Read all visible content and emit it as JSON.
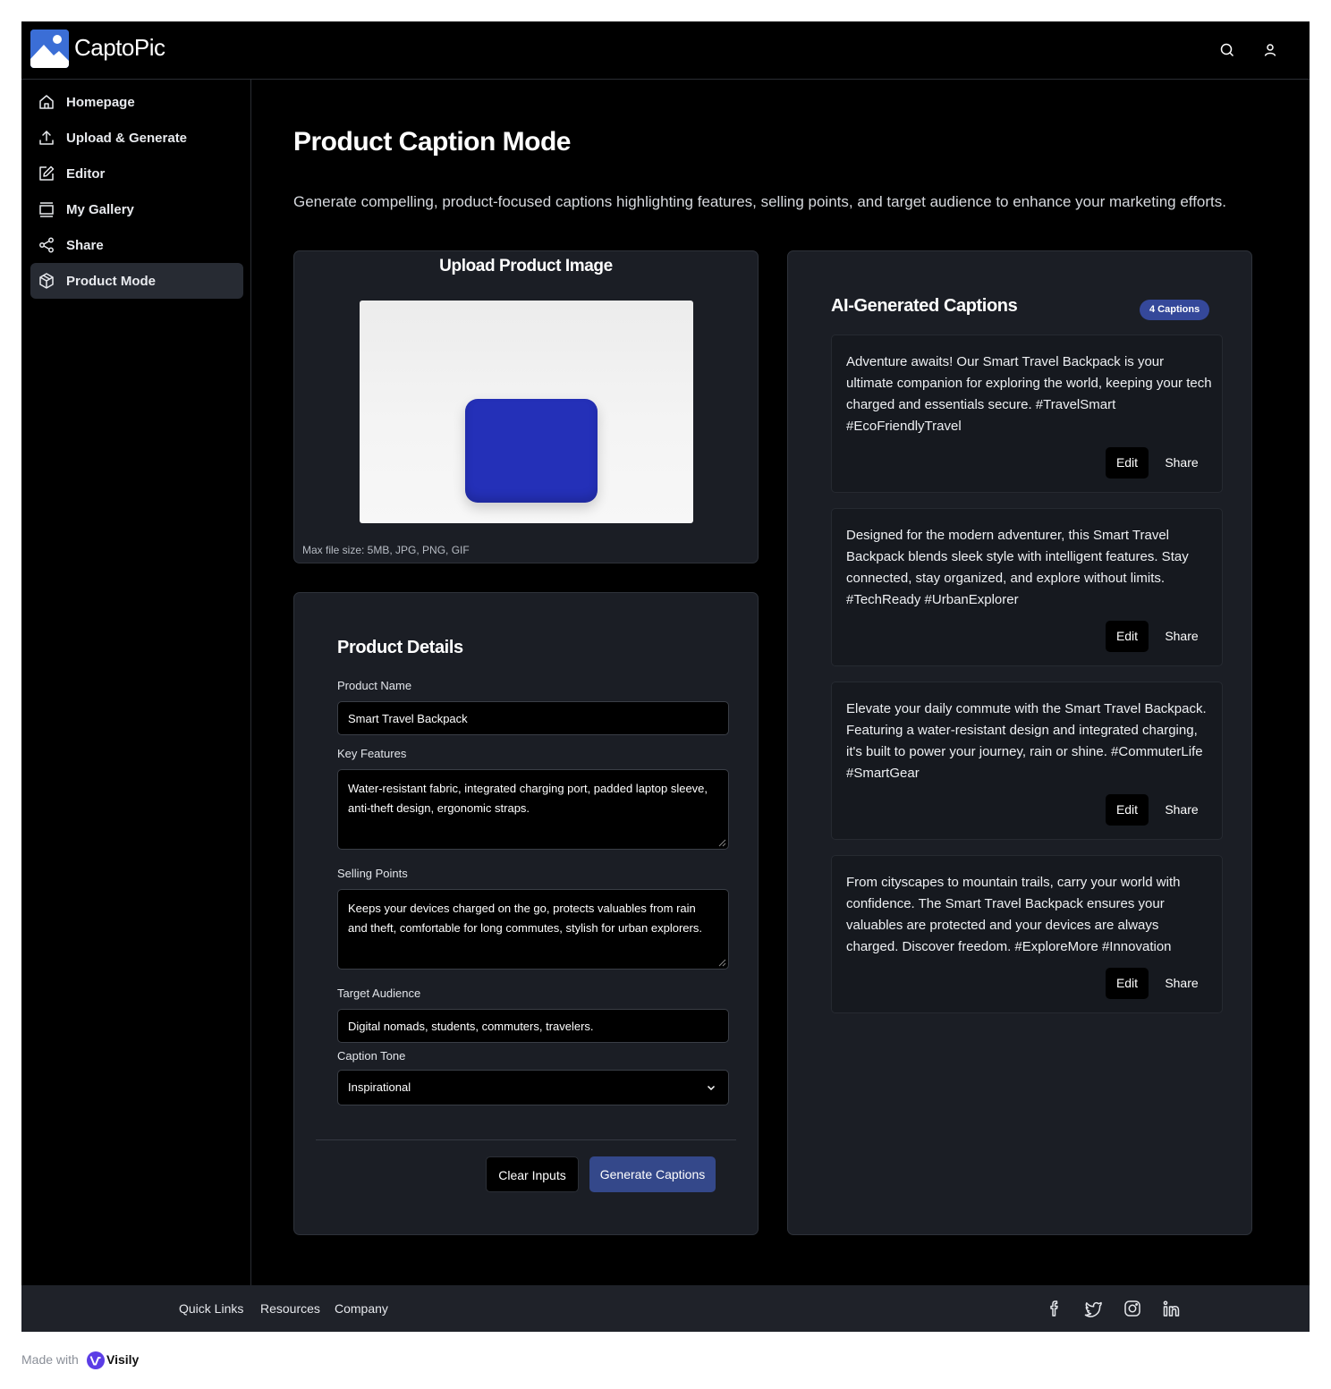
{
  "app": {
    "name": "CaptoPic"
  },
  "header": {
    "search_icon": "search-icon",
    "user_icon": "user-icon"
  },
  "sidebar": {
    "items": [
      {
        "label": "Homepage",
        "icon": "home-icon",
        "active": false
      },
      {
        "label": "Upload & Generate",
        "icon": "upload-icon",
        "active": false
      },
      {
        "label": "Editor",
        "icon": "edit-icon",
        "active": false
      },
      {
        "label": "My Gallery",
        "icon": "gallery-icon",
        "active": false
      },
      {
        "label": "Share",
        "icon": "share-icon",
        "active": false
      },
      {
        "label": "Product Mode",
        "icon": "box-icon",
        "active": true
      }
    ]
  },
  "page": {
    "title": "Product Caption Mode",
    "description": "Generate compelling, product-focused captions highlighting features, selling points, and target audience to enhance your marketing efforts."
  },
  "upload": {
    "title": "Upload Product Image",
    "hint": "Max file size: 5MB, JPG, PNG, GIF"
  },
  "details": {
    "title": "Product Details",
    "product_name_label": "Product Name",
    "product_name_value": "Smart Travel Backpack",
    "key_features_label": "Key Features",
    "key_features_value": "Water-resistant fabric, integrated charging port, padded laptop sleeve, anti-theft design, ergonomic straps.",
    "selling_points_label": "Selling Points",
    "selling_points_value": "Keeps your devices charged on the go, protects valuables from rain and theft, comfortable for long commutes, stylish for urban explorers.",
    "target_audience_label": "Target Audience",
    "target_audience_value": "Digital nomads, students, commuters, travelers.",
    "caption_tone_label": "Caption Tone",
    "caption_tone_value": "Inspirational",
    "clear_label": "Clear Inputs",
    "generate_label": "Generate Captions"
  },
  "captions": {
    "title": "AI-Generated Captions",
    "badge": "4 Captions",
    "items": [
      {
        "text": "Adventure awaits! Our Smart Travel Backpack is your ultimate companion for exploring the world, keeping your tech charged and essentials secure. #TravelSmart #EcoFriendlyTravel",
        "edit": "Edit",
        "share": "Share"
      },
      {
        "text": "Designed for the modern adventurer, this Smart Travel Backpack blends sleek style with intelligent features. Stay connected, stay organized, and explore without limits. #TechReady #UrbanExplorer",
        "edit": "Edit",
        "share": "Share"
      },
      {
        "text": "Elevate your daily commute with the Smart Travel Backpack. Featuring a water-resistant design and integrated charging, it's built to power your journey, rain or shine. #CommuterLife #SmartGear",
        "edit": "Edit",
        "share": "Share"
      },
      {
        "text": "From cityscapes to mountain trails, carry your world with confidence. The Smart Travel Backpack ensures your valuables are protected and your devices are always charged. Discover freedom. #ExploreMore #Innovation",
        "edit": "Edit",
        "share": "Share"
      }
    ]
  },
  "footer": {
    "links": [
      "Quick Links",
      "Resources",
      "Company"
    ],
    "social": [
      "facebook-icon",
      "twitter-icon",
      "instagram-icon",
      "linkedin-icon"
    ]
  },
  "badge": {
    "made_with": "Made with",
    "brand": "Visily"
  },
  "colors": {
    "accent": "#34488a",
    "badge": "#35489a",
    "card": "#1b1e25",
    "logo": "#3b6ed6"
  }
}
